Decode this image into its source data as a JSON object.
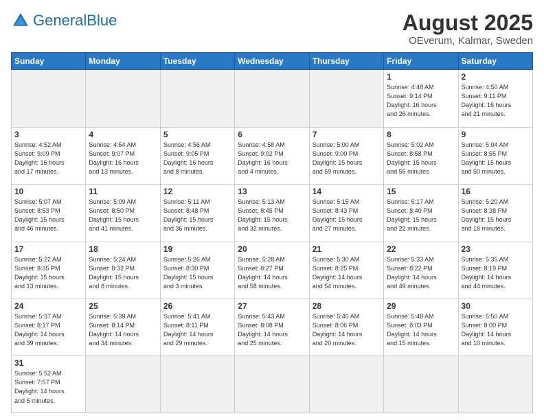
{
  "header": {
    "logo_general": "General",
    "logo_blue": "Blue",
    "month": "August 2025",
    "location": "OEverum, Kalmar, Sweden"
  },
  "weekdays": [
    "Sunday",
    "Monday",
    "Tuesday",
    "Wednesday",
    "Thursday",
    "Friday",
    "Saturday"
  ],
  "weeks": [
    [
      {
        "day": "",
        "info": "",
        "empty": true
      },
      {
        "day": "",
        "info": "",
        "empty": true
      },
      {
        "day": "",
        "info": "",
        "empty": true
      },
      {
        "day": "",
        "info": "",
        "empty": true
      },
      {
        "day": "",
        "info": "",
        "empty": true
      },
      {
        "day": "1",
        "info": "Sunrise: 4:48 AM\nSunset: 9:14 PM\nDaylight: 16 hours\nand 26 minutes."
      },
      {
        "day": "2",
        "info": "Sunrise: 4:50 AM\nSunset: 9:11 PM\nDaylight: 16 hours\nand 21 minutes."
      }
    ],
    [
      {
        "day": "3",
        "info": "Sunrise: 4:52 AM\nSunset: 9:09 PM\nDaylight: 16 hours\nand 17 minutes."
      },
      {
        "day": "4",
        "info": "Sunrise: 4:54 AM\nSunset: 9:07 PM\nDaylight: 16 hours\nand 13 minutes."
      },
      {
        "day": "5",
        "info": "Sunrise: 4:56 AM\nSunset: 9:05 PM\nDaylight: 16 hours\nand 8 minutes."
      },
      {
        "day": "6",
        "info": "Sunrise: 4:58 AM\nSunset: 9:02 PM\nDaylight: 16 hours\nand 4 minutes."
      },
      {
        "day": "7",
        "info": "Sunrise: 5:00 AM\nSunset: 9:00 PM\nDaylight: 15 hours\nand 59 minutes."
      },
      {
        "day": "8",
        "info": "Sunrise: 5:02 AM\nSunset: 8:58 PM\nDaylight: 15 hours\nand 55 minutes."
      },
      {
        "day": "9",
        "info": "Sunrise: 5:04 AM\nSunset: 8:55 PM\nDaylight: 15 hours\nand 50 minutes."
      }
    ],
    [
      {
        "day": "10",
        "info": "Sunrise: 5:07 AM\nSunset: 8:53 PM\nDaylight: 15 hours\nand 46 minutes."
      },
      {
        "day": "11",
        "info": "Sunrise: 5:09 AM\nSunset: 8:50 PM\nDaylight: 15 hours\nand 41 minutes."
      },
      {
        "day": "12",
        "info": "Sunrise: 5:11 AM\nSunset: 8:48 PM\nDaylight: 15 hours\nand 36 minutes."
      },
      {
        "day": "13",
        "info": "Sunrise: 5:13 AM\nSunset: 8:45 PM\nDaylight: 15 hours\nand 32 minutes."
      },
      {
        "day": "14",
        "info": "Sunrise: 5:15 AM\nSunset: 8:43 PM\nDaylight: 15 hours\nand 27 minutes."
      },
      {
        "day": "15",
        "info": "Sunrise: 5:17 AM\nSunset: 8:40 PM\nDaylight: 15 hours\nand 22 minutes."
      },
      {
        "day": "16",
        "info": "Sunrise: 5:20 AM\nSunset: 8:38 PM\nDaylight: 15 hours\nand 18 minutes."
      }
    ],
    [
      {
        "day": "17",
        "info": "Sunrise: 5:22 AM\nSunset: 8:35 PM\nDaylight: 15 hours\nand 13 minutes."
      },
      {
        "day": "18",
        "info": "Sunrise: 5:24 AM\nSunset: 8:32 PM\nDaylight: 15 hours\nand 8 minutes."
      },
      {
        "day": "19",
        "info": "Sunrise: 5:26 AM\nSunset: 8:30 PM\nDaylight: 15 hours\nand 3 minutes."
      },
      {
        "day": "20",
        "info": "Sunrise: 5:28 AM\nSunset: 8:27 PM\nDaylight: 14 hours\nand 58 minutes."
      },
      {
        "day": "21",
        "info": "Sunrise: 5:30 AM\nSunset: 8:25 PM\nDaylight: 14 hours\nand 54 minutes."
      },
      {
        "day": "22",
        "info": "Sunrise: 5:33 AM\nSunset: 8:22 PM\nDaylight: 14 hours\nand 49 minutes."
      },
      {
        "day": "23",
        "info": "Sunrise: 5:35 AM\nSunset: 8:19 PM\nDaylight: 14 hours\nand 44 minutes."
      }
    ],
    [
      {
        "day": "24",
        "info": "Sunrise: 5:37 AM\nSunset: 8:17 PM\nDaylight: 14 hours\nand 39 minutes."
      },
      {
        "day": "25",
        "info": "Sunrise: 5:39 AM\nSunset: 8:14 PM\nDaylight: 14 hours\nand 34 minutes."
      },
      {
        "day": "26",
        "info": "Sunrise: 5:41 AM\nSunset: 8:11 PM\nDaylight: 14 hours\nand 29 minutes."
      },
      {
        "day": "27",
        "info": "Sunrise: 5:43 AM\nSunset: 8:08 PM\nDaylight: 14 hours\nand 25 minutes."
      },
      {
        "day": "28",
        "info": "Sunrise: 5:45 AM\nSunset: 8:06 PM\nDaylight: 14 hours\nand 20 minutes."
      },
      {
        "day": "29",
        "info": "Sunrise: 5:48 AM\nSunset: 8:03 PM\nDaylight: 14 hours\nand 15 minutes."
      },
      {
        "day": "30",
        "info": "Sunrise: 5:50 AM\nSunset: 8:00 PM\nDaylight: 14 hours\nand 10 minutes."
      }
    ],
    [
      {
        "day": "31",
        "info": "Sunrise: 5:52 AM\nSunset: 7:57 PM\nDaylight: 14 hours\nand 5 minutes.",
        "last": true
      },
      {
        "day": "",
        "info": "",
        "empty": true,
        "last": true
      },
      {
        "day": "",
        "info": "",
        "empty": true,
        "last": true
      },
      {
        "day": "",
        "info": "",
        "empty": true,
        "last": true
      },
      {
        "day": "",
        "info": "",
        "empty": true,
        "last": true
      },
      {
        "day": "",
        "info": "",
        "empty": true,
        "last": true
      },
      {
        "day": "",
        "info": "",
        "empty": true,
        "last": true
      }
    ]
  ]
}
